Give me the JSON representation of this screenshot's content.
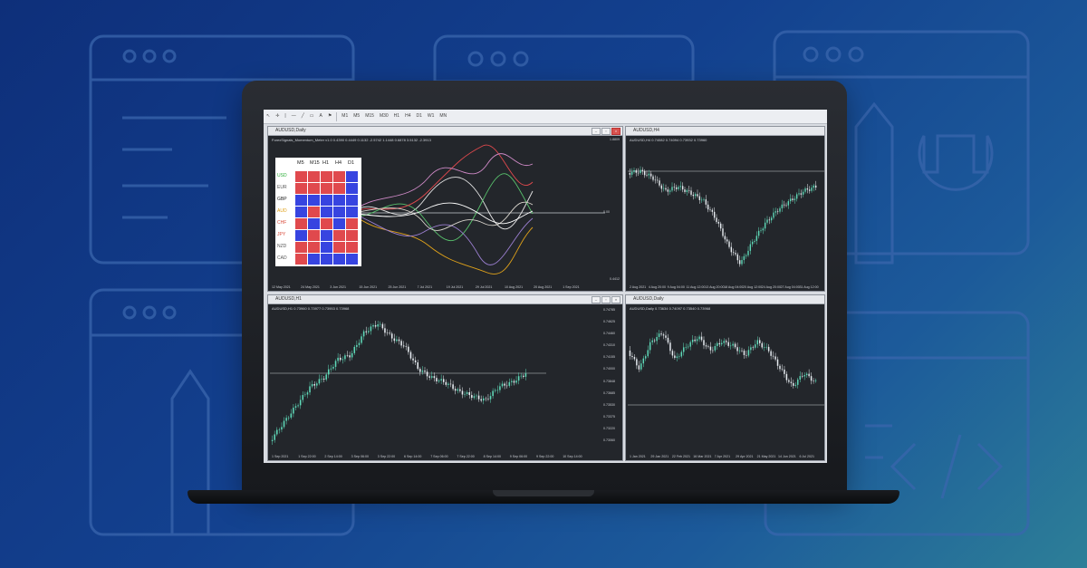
{
  "toolbar": {
    "tools": [
      "↖",
      "✛",
      "|",
      "—",
      "╱",
      "▭",
      "A",
      "⚑"
    ],
    "timeframes": [
      "M1",
      "M5",
      "M15",
      "M30",
      "H1",
      "H4",
      "D1",
      "W1",
      "MN"
    ]
  },
  "windows": {
    "main": {
      "title": "AUDUSD,Daily",
      "indicator_info": "ForexSignals_Momentum_Meter v1.0  0.4390  0.4449  0.1132  -2.5742  1.1448  0.6878  3.5132  -2.3913",
      "axis_right": [
        "1.8809",
        "0.00",
        "0.4412"
      ],
      "axis_bottom": [
        "12 May 2021",
        "24 May 2021",
        "3 Jun 2021",
        "15 Jun 2021",
        "25 Jun 2021",
        "7 Jul 2021",
        "19 Jul 2021",
        "29 Jul 2021",
        "10 Aug 2021",
        "20 Aug 2021",
        "1 Sep 2021"
      ],
      "strength_meter": {
        "columns": [
          "M5",
          "M15",
          "H1",
          "H4",
          "D1"
        ],
        "rows": [
          {
            "label": "USD",
            "color": "#2eae3b",
            "cells": [
              "R",
              "R",
              "R",
              "R",
              "B"
            ]
          },
          {
            "label": "EUR",
            "color": "#555555",
            "cells": [
              "R",
              "R",
              "R",
              "R",
              "B"
            ]
          },
          {
            "label": "GBP",
            "color": "#222222",
            "cells": [
              "B",
              "B",
              "B",
              "B",
              "B"
            ]
          },
          {
            "label": "AUD",
            "color": "#e0a21a",
            "cells": [
              "B",
              "R",
              "B",
              "B",
              "B"
            ]
          },
          {
            "label": "CHF",
            "color": "#d94c3d",
            "cells": [
              "R",
              "B",
              "R",
              "B",
              "R"
            ]
          },
          {
            "label": "JPY",
            "color": "#d94c3d",
            "cells": [
              "B",
              "R",
              "B",
              "R",
              "R"
            ]
          },
          {
            "label": "NZD",
            "color": "#555555",
            "cells": [
              "R",
              "R",
              "B",
              "R",
              "R"
            ]
          },
          {
            "label": "CAD",
            "color": "#555555",
            "cells": [
              "R",
              "B",
              "B",
              "B",
              "B"
            ]
          }
        ]
      }
    },
    "h4": {
      "title": "AUDUSD,H4",
      "info": "AUDUSD,H4  0.74082 0.74094 0.73932 0.73960",
      "axis_bottom": [
        "2 Aug 2021",
        "4 Aug 20:00",
        "9 Aug 04:00",
        "11 Aug 12:00",
        "13 Aug 20:00",
        "18 Aug 04:00",
        "20 Aug 12:00",
        "24 Aug 20:00",
        "27 Aug 04:00",
        "31 Aug 12:00"
      ]
    },
    "h1": {
      "title": "AUDUSD,H1",
      "info": "AUDUSD,H1  0.73960 0.73977 0.73953 0.73968",
      "axis_right": [
        "0.74785",
        "0.74625",
        "0.74460",
        "0.74310",
        "0.74155",
        "0.74000",
        "0.73848",
        "0.73685",
        "0.73530",
        "0.73375",
        "0.73220",
        "0.73060"
      ],
      "axis_bottom": [
        "1 Sep 2021",
        "1 Sep 22:00",
        "2 Sep 14:00",
        "3 Sep 06:00",
        "3 Sep 22:00",
        "6 Sep 14:00",
        "7 Sep 06:00",
        "7 Sep 22:00",
        "8 Sep 14:00",
        "9 Sep 06:00",
        "9 Sep 22:00",
        "10 Sep 14:00"
      ]
    },
    "daily": {
      "title": "AUDUSD,Daily",
      "info": "AUDUSD,Daily  0.73634 0.74097 0.73540 0.73968",
      "axis_bottom": [
        "1 Jan 2021",
        "29 Jan 2021",
        "22 Feb 2021",
        "16 Mar 2021",
        "7 Apr 2021",
        "29 Apr 2021",
        "21 May 2021",
        "14 Jun 2021",
        "6 Jul 2021"
      ]
    }
  },
  "colors": {
    "bull": "#5fd9b8",
    "bear": "#e9eef3",
    "level": "#c9ccd2",
    "red": "#e0494d",
    "blue": "#3744e0"
  }
}
